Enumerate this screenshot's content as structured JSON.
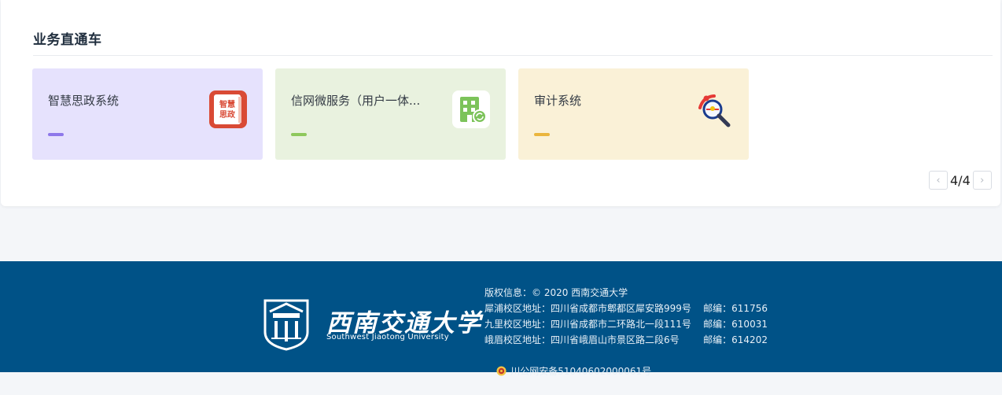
{
  "section": {
    "title": "业务直通车"
  },
  "cards": [
    {
      "title": "智慧思政系统",
      "icon": "smart-politics-app-icon",
      "bg": "#e6e2fd",
      "bar": "#8e78ea",
      "icon_text": [
        "智慧",
        "思政"
      ]
    },
    {
      "title": "信网微服务（用户一体...",
      "icon": "building-refresh-app-icon",
      "bg": "#e9f2df",
      "bar": "#8ec85c"
    },
    {
      "title": "审计系统",
      "icon": "audit-magnifier-icon",
      "bg": "#faf1d7",
      "bar": "#eab53d"
    }
  ],
  "pager": {
    "text": "4/4",
    "prev": "‹",
    "next": "›"
  },
  "footer": {
    "logo_cn": "西南交通大学",
    "logo_en": "Southwest Jiaotong University",
    "copyright": "版权信息：© 2020 西南交通大学",
    "campuses": [
      "犀浦校区地址：四川省成都市郫都区犀安路999号    邮编：611756",
      "九里校区地址：四川省成都市二环路北一段111号    邮编：610031",
      "峨眉校区地址：四川省峨眉山市景区路二段6号        邮编：614202"
    ],
    "icp": "川公网安备51040602000061号"
  },
  "colors": {
    "footer_bg": "#005287",
    "title": "#1f2d3d"
  }
}
